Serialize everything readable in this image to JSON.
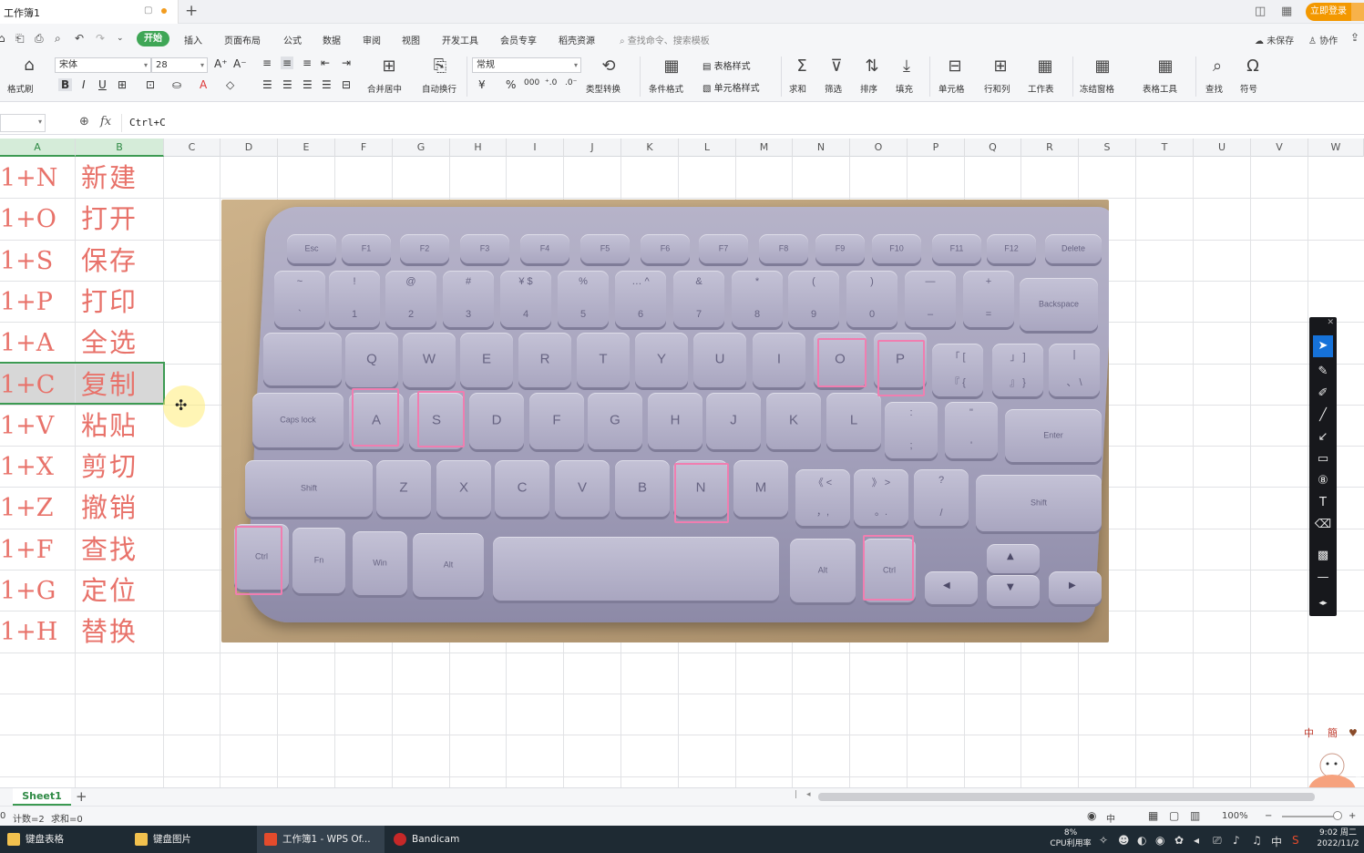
{
  "titlebar": {
    "tab_title": "工作簿1",
    "login": "立即登录"
  },
  "menu": {
    "items": [
      "开始",
      "插入",
      "页面布局",
      "公式",
      "数据",
      "审阅",
      "视图",
      "开发工具",
      "会员专享",
      "稻壳资源"
    ],
    "search_placeholder": "查找命令、搜索模板",
    "unsaved": "未保存",
    "collab": "协作"
  },
  "ribbon": {
    "format_painter": "格式刷",
    "font_name": "宋体",
    "font_size": "28",
    "merge_center": "合并居中",
    "wrap_text": "自动换行",
    "number_format": "常规",
    "type_convert": "类型转换",
    "cond_format": "条件格式",
    "table_style": "表格样式",
    "cell_style": "单元格样式",
    "sum": "求和",
    "filter": "筛选",
    "sort": "排序",
    "fill": "填充",
    "cell": "单元格",
    "row_col": "行和列",
    "worksheet": "工作表",
    "freeze": "冻结窗格",
    "table_tools": "表格工具",
    "find": "查找",
    "symbol": "符号"
  },
  "formula": {
    "fx": "fx",
    "value": "Ctrl+C"
  },
  "columns": [
    "A",
    "B",
    "C",
    "D",
    "E",
    "F",
    "G",
    "H",
    "I",
    "J",
    "K",
    "L",
    "M",
    "N",
    "O",
    "P",
    "Q",
    "R",
    "S",
    "T",
    "U",
    "V",
    "W"
  ],
  "rows": [
    {
      "a": "1+N",
      "b": "新建"
    },
    {
      "a": "1+O",
      "b": "打开"
    },
    {
      "a": "1+S",
      "b": "保存"
    },
    {
      "a": "1+P",
      "b": "打印"
    },
    {
      "a": "1+A",
      "b": "全选"
    },
    {
      "a": "1+C",
      "b": "复制"
    },
    {
      "a": "1+V",
      "b": "粘贴"
    },
    {
      "a": "1+X",
      "b": "剪切"
    },
    {
      "a": "1+Z",
      "b": "撤销"
    },
    {
      "a": "1+F",
      "b": "查找"
    },
    {
      "a": "1+G",
      "b": "定位"
    },
    {
      "a": "1+H",
      "b": "替换"
    }
  ],
  "keyboard": {
    "fn_row": [
      "Esc",
      "F1",
      "F2",
      "F3",
      "F4",
      "F5",
      "F6",
      "F7",
      "F8",
      "F9",
      "F10",
      "F11",
      "F12",
      "Delete"
    ],
    "num_row": [
      [
        "~",
        "`"
      ],
      [
        "!",
        "1"
      ],
      [
        "@",
        "2"
      ],
      [
        "#",
        "3"
      ],
      [
        "¥ $",
        "4"
      ],
      [
        "%",
        "5"
      ],
      [
        "… ^",
        "6"
      ],
      [
        "&",
        "7"
      ],
      [
        "*",
        "8"
      ],
      [
        "(",
        "9"
      ],
      [
        ")",
        "0"
      ],
      [
        "—",
        "–"
      ],
      [
        "+",
        "="
      ]
    ],
    "backspace": "Backspace",
    "row_q": [
      "Q",
      "W",
      "E",
      "R",
      "T",
      "Y",
      "U",
      "I",
      "O",
      "P"
    ],
    "row_q_punct": [
      [
        "「 [",
        "『 {"
      ],
      [
        "」 ]",
        "』 }"
      ],
      [
        "|",
        "、 \\"
      ]
    ],
    "caps": "Caps lock",
    "row_a": [
      "A",
      "S",
      "D",
      "F",
      "G",
      "H",
      "J",
      "K",
      "L"
    ],
    "row_a_punct": [
      [
        ":",
        ";"
      ],
      [
        "\"",
        "'"
      ]
    ],
    "enter": "Enter",
    "shift": "Shift",
    "row_z": [
      "Z",
      "X",
      "C",
      "V",
      "B",
      "N",
      "M"
    ],
    "row_z_punct": [
      [
        "《 <",
        "，,"
      ],
      [
        "》 >",
        "。."
      ],
      [
        "?",
        "/"
      ]
    ],
    "ctrl": "Ctrl",
    "fn": "Fn",
    "win": "Win",
    "alt": "Alt"
  },
  "sheet": {
    "tab": "Sheet1"
  },
  "status": {
    "count": "计数=2",
    "sum": "求和=0",
    "zoom": "100%",
    "lang": "中"
  },
  "taskbar": {
    "items": [
      "键盘表格",
      "键盘图片",
      "工作簿1 - WPS Of...",
      "Bandicam"
    ],
    "cpu_pct": "8%",
    "cpu_label": "CPU利用率",
    "time": "9:02 周二",
    "date": "2022/11/2"
  },
  "colors": {
    "accent": "#3c9a52",
    "highlight": "#f07eb0",
    "cell_text": "#e8726a",
    "login": "#f39800"
  }
}
